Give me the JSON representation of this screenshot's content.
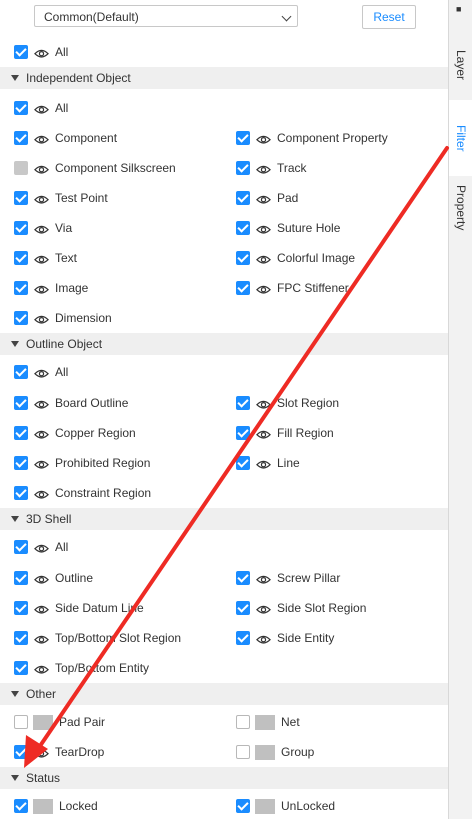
{
  "header": {
    "select_value": "Common(Default)",
    "reset_label": "Reset"
  },
  "tabs": [
    {
      "label": "Layer",
      "active": false
    },
    {
      "label": "Filter",
      "active": true
    },
    {
      "label": "Property",
      "active": false
    }
  ],
  "rows": [
    {
      "type": "item",
      "items": [
        {
          "label": "All",
          "state": "on",
          "icon": "eye-icon"
        }
      ]
    },
    {
      "type": "section",
      "label": "Independent Object"
    },
    {
      "type": "item",
      "items": [
        {
          "label": "All",
          "state": "on",
          "icon": "eye-icon"
        }
      ]
    },
    {
      "type": "item",
      "items": [
        {
          "label": "Component",
          "state": "on",
          "icon": "eye-icon"
        },
        {
          "label": "Component Property",
          "state": "on",
          "icon": "eye-icon"
        }
      ]
    },
    {
      "type": "item",
      "items": [
        {
          "label": "Component Silkscreen",
          "state": "dis",
          "icon": "eye-icon"
        },
        {
          "label": "Track",
          "state": "on",
          "icon": "eye-icon"
        }
      ]
    },
    {
      "type": "item",
      "items": [
        {
          "label": "Test Point",
          "state": "on",
          "icon": "eye-icon"
        },
        {
          "label": "Pad",
          "state": "on",
          "icon": "eye-icon"
        }
      ]
    },
    {
      "type": "item",
      "items": [
        {
          "label": "Via",
          "state": "on",
          "icon": "eye-icon"
        },
        {
          "label": "Suture Hole",
          "state": "on",
          "icon": "eye-icon"
        }
      ]
    },
    {
      "type": "item",
      "items": [
        {
          "label": "Text",
          "state": "on",
          "icon": "eye-icon"
        },
        {
          "label": "Colorful Image",
          "state": "on",
          "icon": "eye-icon"
        }
      ]
    },
    {
      "type": "item",
      "items": [
        {
          "label": "Image",
          "state": "on",
          "icon": "eye-icon"
        },
        {
          "label": "FPC Stiffener",
          "state": "on",
          "icon": "eye-icon"
        }
      ]
    },
    {
      "type": "item",
      "items": [
        {
          "label": "Dimension",
          "state": "on",
          "icon": "eye-icon"
        }
      ]
    },
    {
      "type": "section",
      "label": "Outline Object"
    },
    {
      "type": "item",
      "items": [
        {
          "label": "All",
          "state": "on",
          "icon": "eye-icon"
        }
      ]
    },
    {
      "type": "item",
      "items": [
        {
          "label": "Board Outline",
          "state": "on",
          "icon": "eye-icon"
        },
        {
          "label": "Slot Region",
          "state": "on",
          "icon": "eye-icon"
        }
      ]
    },
    {
      "type": "item",
      "items": [
        {
          "label": "Copper Region",
          "state": "on",
          "icon": "eye-icon"
        },
        {
          "label": "Fill Region",
          "state": "on",
          "icon": "eye-icon"
        }
      ]
    },
    {
      "type": "item",
      "items": [
        {
          "label": "Prohibited Region",
          "state": "on",
          "icon": "eye-icon"
        },
        {
          "label": "Line",
          "state": "on",
          "icon": "eye-icon"
        }
      ]
    },
    {
      "type": "item",
      "items": [
        {
          "label": "Constraint Region",
          "state": "on",
          "icon": "eye-icon"
        }
      ]
    },
    {
      "type": "section",
      "label": "3D Shell"
    },
    {
      "type": "item",
      "items": [
        {
          "label": "All",
          "state": "on",
          "icon": "eye-icon"
        }
      ]
    },
    {
      "type": "item",
      "items": [
        {
          "label": "Outline",
          "state": "on",
          "icon": "eye-icon"
        },
        {
          "label": "Screw Pillar",
          "state": "on",
          "icon": "eye-icon"
        }
      ]
    },
    {
      "type": "item",
      "items": [
        {
          "label": "Side Datum Line",
          "state": "on",
          "icon": "eye-icon"
        },
        {
          "label": "Side Slot Region",
          "state": "on",
          "icon": "eye-icon"
        }
      ]
    },
    {
      "type": "item",
      "items": [
        {
          "label": "Top/Bottom Slot Region",
          "state": "on",
          "icon": "eye-icon"
        },
        {
          "label": "Side Entity",
          "state": "on",
          "icon": "eye-icon"
        }
      ]
    },
    {
      "type": "item",
      "items": [
        {
          "label": "Top/Bottom Entity",
          "state": "on",
          "icon": "eye-icon"
        }
      ]
    },
    {
      "type": "section",
      "label": "Other"
    },
    {
      "type": "item",
      "items": [
        {
          "label": "Pad Pair",
          "state": "off",
          "icon": "swatch"
        },
        {
          "label": "Net",
          "state": "off",
          "icon": "swatch"
        }
      ]
    },
    {
      "type": "item",
      "items": [
        {
          "label": "TearDrop",
          "state": "on",
          "icon": "eye-icon"
        },
        {
          "label": "Group",
          "state": "off",
          "icon": "swatch"
        }
      ]
    },
    {
      "type": "section",
      "label": "Status"
    },
    {
      "type": "item",
      "items": [
        {
          "label": "Locked",
          "state": "on",
          "icon": "swatch"
        },
        {
          "label": "UnLocked",
          "state": "on",
          "icon": "swatch"
        }
      ]
    }
  ],
  "colors": {
    "accent": "#1a8cff",
    "arrow": "#ee2b24",
    "section_bg": "#efefef"
  }
}
